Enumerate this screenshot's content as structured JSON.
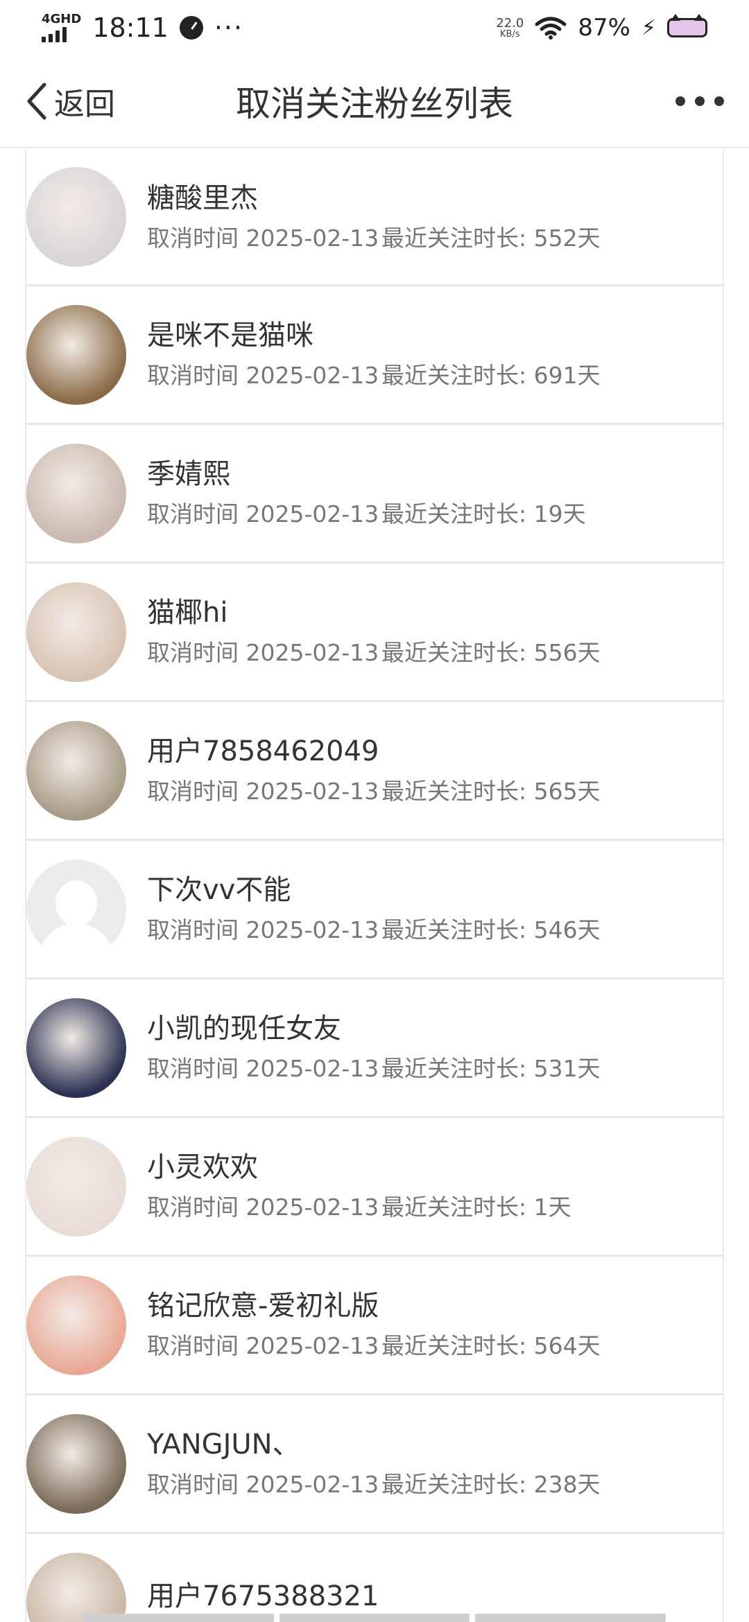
{
  "status_bar": {
    "network": "4GHD",
    "time": "18:11",
    "more": "···",
    "speed_value": "22.0",
    "speed_unit": "KB/s",
    "battery": "87%"
  },
  "nav": {
    "back_label": "返回",
    "title": "取消关注粉丝列表"
  },
  "list": {
    "items": [
      {
        "name": "糖酸里杰",
        "cancel_time": "取消时间 2025-02-13",
        "duration": "最近关注时长: 552天",
        "avatar_color": "#d9d4d8"
      },
      {
        "name": "是咪不是猫咪",
        "cancel_time": "取消时间 2025-02-13",
        "duration": "最近关注时长: 691天",
        "avatar_color": "#8a6a45"
      },
      {
        "name": "季婧熙",
        "cancel_time": "取消时间 2025-02-13",
        "duration": "最近关注时长: 19天",
        "avatar_color": "#c9b9ae"
      },
      {
        "name": "猫椰hi",
        "cancel_time": "取消时间 2025-02-13",
        "duration": "最近关注时长: 556天",
        "avatar_color": "#d8c3b3"
      },
      {
        "name": "用户7858462049",
        "cancel_time": "取消时间 2025-02-13",
        "duration": "最近关注时长: 565天",
        "avatar_color": "#a79a86"
      },
      {
        "name": "下次vv不能",
        "cancel_time": "取消时间 2025-02-13",
        "duration": "最近关注时长: 546天",
        "avatar_color": "default"
      },
      {
        "name": "小凯的现任女友",
        "cancel_time": "取消时间 2025-02-13",
        "duration": "最近关注时长: 531天",
        "avatar_color": "#2a3050"
      },
      {
        "name": "小灵欢欢",
        "cancel_time": "取消时间 2025-02-13",
        "duration": "最近关注时长: 1天",
        "avatar_color": "#e8ddd6"
      },
      {
        "name": "铭记欣意-爱初礼版",
        "cancel_time": "取消时间 2025-02-13",
        "duration": "最近关注时长: 564天",
        "avatar_color": "#e9a893"
      },
      {
        "name": "YANGJUN、",
        "cancel_time": "取消时间 2025-02-13",
        "duration": "最近关注时长: 238天",
        "avatar_color": "#7a6a58"
      },
      {
        "name": "用户7675388321",
        "cancel_time": "",
        "duration": "",
        "avatar_color": "#c8b6a4"
      }
    ]
  }
}
